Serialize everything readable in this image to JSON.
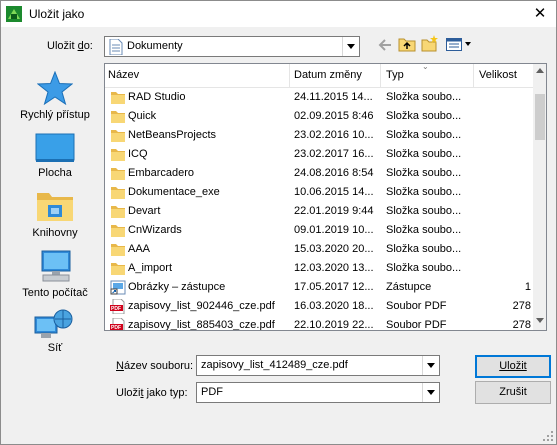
{
  "window": {
    "title": "Uložit jako",
    "close_glyph": "✕"
  },
  "location": {
    "label": "Uložit do:",
    "label_accesskey": "d",
    "value": "Dokumenty"
  },
  "toolbar": {
    "back_icon": "back-arrow-icon",
    "up_icon": "folder-up-icon",
    "new_folder_icon": "new-folder-icon",
    "view_icon": "view-menu-icon"
  },
  "places": [
    {
      "label": "Rychlý přístup",
      "icon": "star-icon"
    },
    {
      "label": "Plocha",
      "icon": "desktop-icon"
    },
    {
      "label": "Knihovny",
      "icon": "libraries-icon"
    },
    {
      "label": "Tento počítač",
      "icon": "computer-icon"
    },
    {
      "label": "Síť",
      "icon": "network-icon"
    }
  ],
  "columns": {
    "name": "Název",
    "date": "Datum změny",
    "type": "Typ",
    "size": "Velikost"
  },
  "files": [
    {
      "name": "RAD Studio",
      "date": "24.11.2015 14...",
      "type": "Složka soubo...",
      "size": "",
      "icon": "folder"
    },
    {
      "name": "Quick",
      "date": "02.09.2015 8:46",
      "type": "Složka soubo...",
      "size": "",
      "icon": "folder"
    },
    {
      "name": "NetBeansProjects",
      "date": "23.02.2016 10...",
      "type": "Složka soubo...",
      "size": "",
      "icon": "folder"
    },
    {
      "name": "ICQ",
      "date": "23.02.2017 16...",
      "type": "Složka soubo...",
      "size": "",
      "icon": "folder"
    },
    {
      "name": "Embarcadero",
      "date": "24.08.2016 8:54",
      "type": "Složka soubo...",
      "size": "",
      "icon": "folder"
    },
    {
      "name": "Dokumentace_exe",
      "date": "10.06.2015 14...",
      "type": "Složka soubo...",
      "size": "",
      "icon": "folder"
    },
    {
      "name": "Devart",
      "date": "22.01.2019 9:44",
      "type": "Složka soubo...",
      "size": "",
      "icon": "folder"
    },
    {
      "name": "CnWizards",
      "date": "09.01.2019 10...",
      "type": "Složka soubo...",
      "size": "",
      "icon": "folder"
    },
    {
      "name": "AAA",
      "date": "15.03.2020 20...",
      "type": "Složka soubo...",
      "size": "",
      "icon": "folder"
    },
    {
      "name": "A_import",
      "date": "12.03.2020 13...",
      "type": "Složka soubo...",
      "size": "",
      "icon": "folder"
    },
    {
      "name": "Obrázky – zástupce",
      "date": "17.05.2017 12...",
      "type": "Zástupce",
      "size": "1 ",
      "icon": "shortcut"
    },
    {
      "name": "zapisovy_list_902446_cze.pdf",
      "date": "16.03.2020 18...",
      "type": "Soubor PDF",
      "size": "278 ",
      "icon": "pdf"
    },
    {
      "name": "zapisovy_list_885403_cze.pdf",
      "date": "22.10.2019 22...",
      "type": "Soubor PDF",
      "size": "278 ",
      "icon": "pdf"
    }
  ],
  "filename": {
    "label": "Název souboru:",
    "label_accesskey": "N",
    "value": "zapisovy_list_412489_cze.pdf"
  },
  "filetype": {
    "label": "Uložit jako typ:",
    "label_accesskey": "t",
    "value": "PDF"
  },
  "buttons": {
    "save": "Uložit",
    "cancel": "Zrušit"
  },
  "pdf_badge": "PDF",
  "colors": {
    "folder": "#f8d775",
    "folder_dark": "#e8b84a",
    "accent": "#0078d7",
    "pdf_red": "#d0021b"
  }
}
